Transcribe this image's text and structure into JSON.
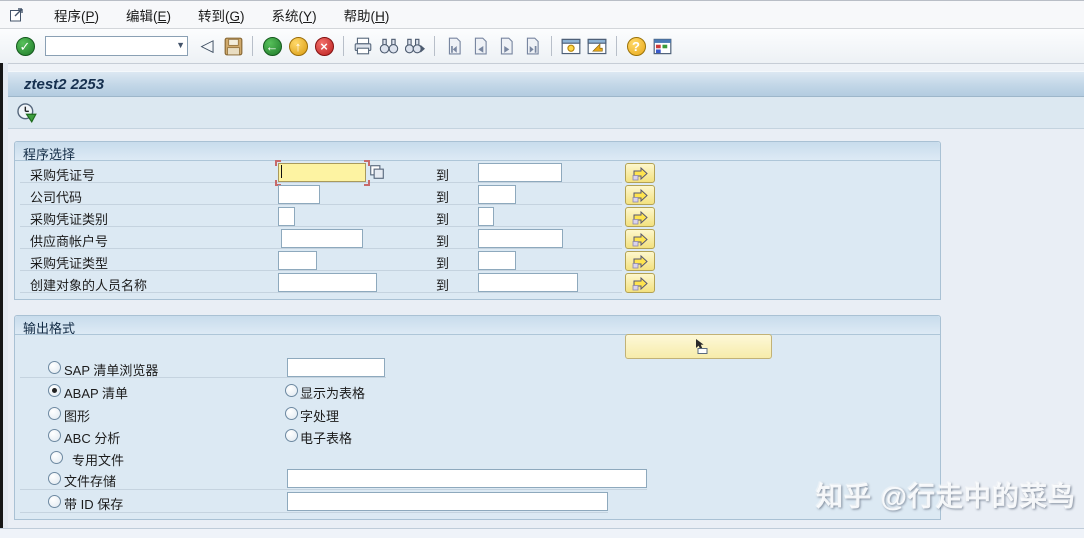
{
  "window": {
    "menu_items": [
      {
        "label": "程序(P)"
      },
      {
        "label": "编辑(E)"
      },
      {
        "label": "转到(G)"
      },
      {
        "label": "系统(Y)"
      },
      {
        "label": "帮助(H)"
      }
    ]
  },
  "toolbar": {
    "command_field_value": "",
    "glyphs": {
      "enter": "✓",
      "back": "◁",
      "nav_back": "←",
      "nav_exit": "↑",
      "nav_cancel": "×",
      "help": "?",
      "dropdown": "▼"
    },
    "icon_names": [
      "enter",
      "command-field",
      "back",
      "save",
      "nav-back",
      "nav-exit",
      "nav-cancel",
      "print",
      "find",
      "find-next",
      "first-page",
      "previous-page",
      "next-page",
      "last-page",
      "new-session",
      "create-shortcut",
      "help",
      "customize-layout"
    ]
  },
  "screen_title": "ztest2 2253",
  "app_toolbar": {
    "icon_names": [
      "execute"
    ]
  },
  "selection_group": {
    "title": "程序选择",
    "to_label": "到",
    "rows": [
      {
        "label": "采购凭证号",
        "value": "",
        "to_value": ""
      },
      {
        "label": "公司代码",
        "value": "",
        "to_value": ""
      },
      {
        "label": "采购凭证类别",
        "value": "",
        "to_value": ""
      },
      {
        "label": "供应商帐户号",
        "value": "",
        "to_value": ""
      },
      {
        "label": "采购凭证类型",
        "value": "",
        "to_value": ""
      },
      {
        "label": "创建对象的人员名称",
        "value": "",
        "to_value": ""
      }
    ]
  },
  "output_group": {
    "title": "输出格式",
    "action_button_label": "",
    "rows": [
      {
        "col1": "SAP 清单浏览器",
        "selected": false,
        "input_value": ""
      },
      {
        "col1": "ABAP 清单",
        "selected": true,
        "col2": "显示为表格",
        "col2_selected": false
      },
      {
        "col1": "图形",
        "selected": false,
        "col2": "字处理",
        "col2_selected": false
      },
      {
        "col1": "ABC 分析",
        "selected": false,
        "col2": "电子表格",
        "col2_selected": false
      },
      {
        "col1": "专用文件",
        "selected": false
      },
      {
        "col1": "文件存储",
        "selected": false,
        "input_value": ""
      },
      {
        "col1": "带 ID 保存",
        "selected": false,
        "input_value": ""
      }
    ]
  },
  "watermark_text": "知乎 @行走中的菜鸟",
  "colors": {
    "focus_field": "#fdf3a2",
    "multiselect_button": "#f3e17f",
    "titlebar": "#c2d6e7",
    "group_body": "#dce9f3",
    "main_bg": "#e9eef5"
  }
}
